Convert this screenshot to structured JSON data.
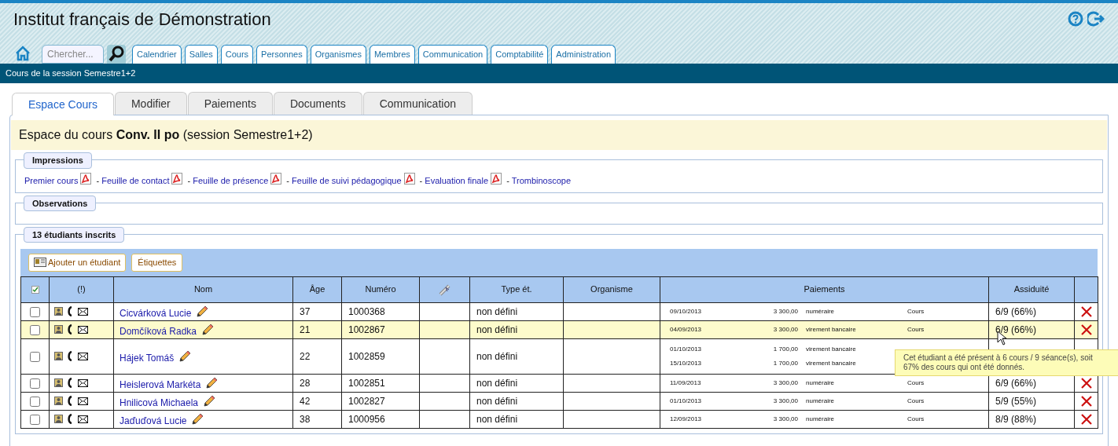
{
  "site_title": "Institut français de Démonstration",
  "search": {
    "placeholder": "Chercher..."
  },
  "nav": [
    {
      "label": "Calendrier"
    },
    {
      "label": "Salles"
    },
    {
      "label": "Cours"
    },
    {
      "label": "Personnes"
    },
    {
      "label": "Organismes"
    },
    {
      "label": "Membres"
    },
    {
      "label": "Communication"
    },
    {
      "label": "Comptabilité"
    },
    {
      "label": "Administration"
    }
  ],
  "breadcrumb": "Cours de la session Semestre1+2",
  "tabs": [
    {
      "label": "Espace Cours",
      "selected": true
    },
    {
      "label": "Modifier",
      "selected": false
    },
    {
      "label": "Paiements",
      "selected": false
    },
    {
      "label": "Documents",
      "selected": false
    },
    {
      "label": "Communication",
      "selected": false
    }
  ],
  "course_heading": "Espace du cours **Conv. II po** (session Semestre1+2)",
  "impressions": {
    "legend": "Impressions",
    "links": [
      "Premier cours",
      "Feuille de contact",
      "Feuille de présence",
      "Feuille de suivi pédagogique",
      "Evaluation finale",
      "Trombinoscope"
    ],
    "separator": "-"
  },
  "observations": {
    "legend": "Observations"
  },
  "students": {
    "legend": "13 étudiants inscrits",
    "buttons": [
      "Ajouter un étudiant",
      "Étiquettes"
    ],
    "columns": [
      "(!)",
      "Nom",
      "Âge",
      "Numéro",
      "Type ét.",
      "Organisme",
      "Paiements",
      "Assiduité"
    ],
    "rows": [
      {
        "name": "Cicvárková Lucie",
        "age": "37",
        "number": "1000368",
        "type": "non défini",
        "highlighted": false,
        "checked": false,
        "payments": [
          {
            "date": "09/10/2013",
            "amount": "3 300,00",
            "mode": "numéraire",
            "category": "Cours"
          }
        ],
        "attendance": "6/9 (66%)"
      },
      {
        "name": "Domčíková Radka",
        "age": "21",
        "number": "1002867",
        "type": "non défini",
        "highlighted": true,
        "checked": false,
        "payments": [
          {
            "date": "04/09/2013",
            "amount": "3 300,00",
            "mode": "virement bancaire",
            "category": "Cours"
          }
        ],
        "attendance": "6/9 (66%)"
      },
      {
        "name": "Hájek Tomáš",
        "age": "22",
        "number": "1002859",
        "type": "non défini",
        "highlighted": false,
        "checked": false,
        "payments": [
          {
            "date": "01/10/2013",
            "amount": "1 700,00",
            "mode": "virement bancaire"
          },
          {
            "date": "15/10/2013",
            "amount": "1 700,00",
            "mode": "virement bancaire"
          }
        ]
      },
      {
        "name": "Heislerová Markéta",
        "age": "28",
        "number": "1002851",
        "type": "non défini",
        "highlighted": false,
        "checked": false,
        "payments": [
          {
            "date": "11/09/2013",
            "amount": "3 300,00",
            "mode": "numéraire",
            "category": "Cours"
          }
        ],
        "attendance": "6/9 (66%)"
      },
      {
        "name": "Hnilicová Michaela",
        "age": "42",
        "number": "1002827",
        "type": "non défini",
        "highlighted": false,
        "checked": false,
        "payments": [
          {
            "date": "01/10/2013",
            "amount": "3 300,00",
            "mode": "numéraire",
            "category": "Cours"
          }
        ],
        "attendance": "5/9 (55%)"
      },
      {
        "name": "Jaďuďová Lucie",
        "age": "38",
        "number": "1000956",
        "type": "non défini",
        "highlighted": false,
        "checked": false,
        "payments": [
          {
            "date": "12/09/2013",
            "amount": "3 300,00",
            "mode": "numéraire",
            "category": "Cours"
          }
        ],
        "attendance": "8/9 (88%)"
      }
    ]
  },
  "tooltip": "Cet étudiant a été présent à 6 cours / 9 séance(s), soit 67% des cours qui ont été donnés."
}
